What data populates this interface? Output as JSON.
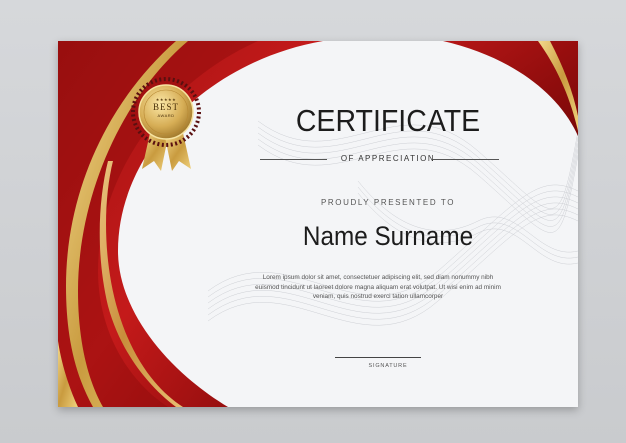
{
  "certificate": {
    "title": "CERTIFICATE",
    "subtitle": "OF APPRECIATION",
    "presented": "PROUDLY PRESENTED TO",
    "name": "Name Surname",
    "body": "Lorem ipsum dolor sit amet, consectetuer adipiscing elit, sed diam nonummy nibh euismod tincidunt ut laoreet dolore magna aliquam erat volutpat. Ut wisi enim ad minim veniam, quis nostrud exerci tation ullamcorper",
    "signature_label": "SIGNATURE"
  },
  "badge": {
    "line1": "BEST",
    "line2": "AWARD",
    "stars": "★★★★★"
  },
  "colors": {
    "red_dark": "#8e0b0b",
    "red": "#b31414",
    "gold": "#d9b45a",
    "paper": "#f4f5f7"
  }
}
